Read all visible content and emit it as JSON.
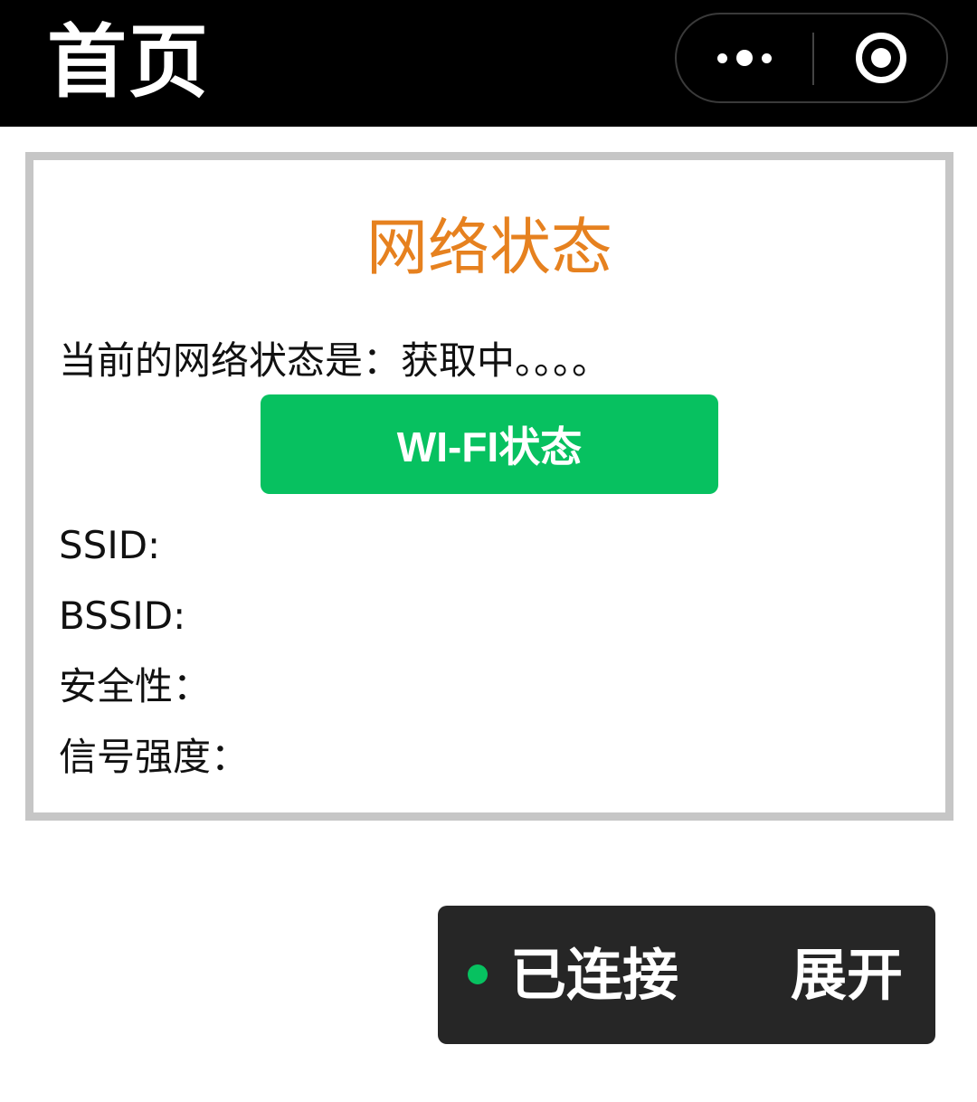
{
  "navbar": {
    "title": "首页",
    "more_icon": "more-dots-icon",
    "close_icon": "target-circle-icon"
  },
  "network_card": {
    "title": "网络状态",
    "status_text": "当前的网络状态是：获取中。。。。",
    "wifi_button_label": "WI-FI状态",
    "ssid_label": "SSID:",
    "bssid_label": "BSSID:",
    "security_label": "安全性：",
    "signal_label": "信号强度："
  },
  "connection_bar": {
    "status_label": "已连接",
    "expand_label": "展开",
    "status_color": "#07c160"
  },
  "colors": {
    "title_orange": "#e6811f",
    "button_green": "#07c160",
    "navbar_bg": "#000000",
    "bar_bg": "#262626"
  }
}
